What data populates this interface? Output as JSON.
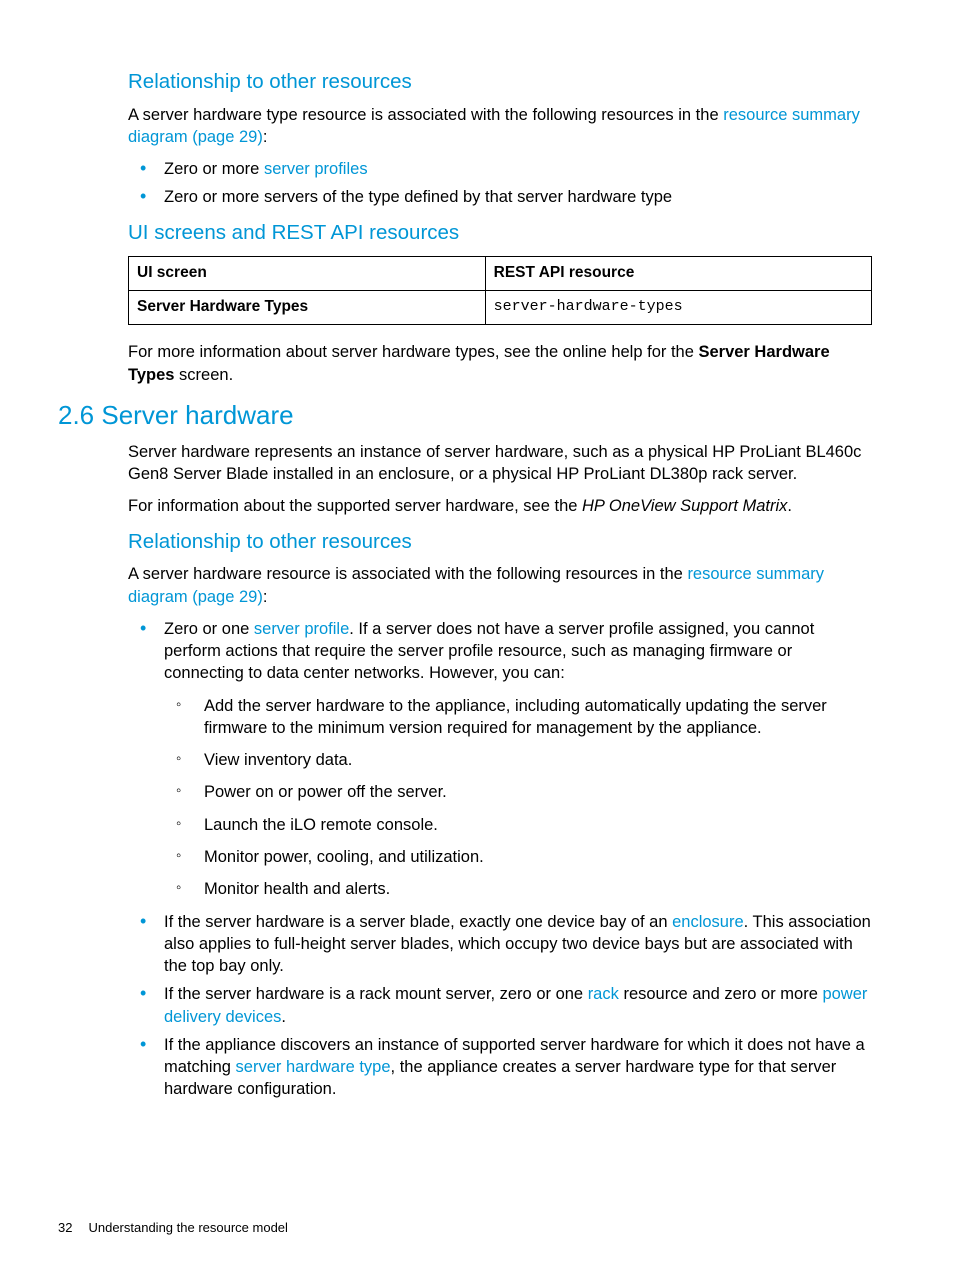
{
  "sec1": {
    "h_rel": "Relationship to other resources",
    "p1a": "A server hardware type resource is associated with the following resources in the ",
    "p1b": "resource summary diagram (page 29)",
    "p1c": ":",
    "li1a": "Zero or more ",
    "li1b": "server profiles",
    "li2": "Zero or more servers of the type defined by that server hardware type",
    "h_ui": "UI screens and REST API resources",
    "th1": "UI screen",
    "th2": "REST API resource",
    "td1": "Server Hardware Types",
    "td2": "server-hardware-types",
    "p2a": "For more information about server hardware types, see the online help for the ",
    "p2b": "Server Hardware Types",
    "p2c": " screen."
  },
  "sec2": {
    "h": "2.6 Server hardware",
    "p1": "Server hardware represents an instance of server hardware, such as a physical HP ProLiant BL460c Gen8 Server Blade installed in an enclosure, or a physical HP ProLiant DL380p rack server.",
    "p2a": "For information about the supported server hardware, see the ",
    "p2b": "HP OneView Support Matrix",
    "p2c": ".",
    "h_rel": "Relationship to other resources",
    "p3a": "A server hardware resource is associated with the following resources in the ",
    "p3b": "resource summary diagram (page 29)",
    "p3c": ":",
    "b1a": "Zero or one ",
    "b1b": "server profile",
    "b1c": ". If a server does not have a server profile assigned, you cannot perform actions that require the server profile resource, such as managing firmware or connecting to data center networks. However, you can:",
    "s1": "Add the server hardware to the appliance, including automatically updating the server firmware to the minimum version required for management by the appliance.",
    "s2": "View inventory data.",
    "s3": "Power on or power off the server.",
    "s4": "Launch the iLO remote console.",
    "s5": "Monitor power, cooling, and utilization.",
    "s6": "Monitor health and alerts.",
    "b2a": "If the server hardware is a server blade, exactly one device bay of an ",
    "b2b": "enclosure",
    "b2c": ". This association also applies to full-height server blades, which occupy two device bays but are associated with the top bay only.",
    "b3a": "If the server hardware is a rack mount server, zero or one ",
    "b3b": "rack",
    "b3c": " resource and zero or more ",
    "b3d": "power delivery devices",
    "b3e": ".",
    "b4a": "If the appliance discovers an instance of supported server hardware for which it does not have a matching ",
    "b4b": "server hardware type",
    "b4c": ", the appliance creates a server hardware type for that server hardware configuration."
  },
  "footer": {
    "page": "32",
    "title": "Understanding the resource model"
  }
}
